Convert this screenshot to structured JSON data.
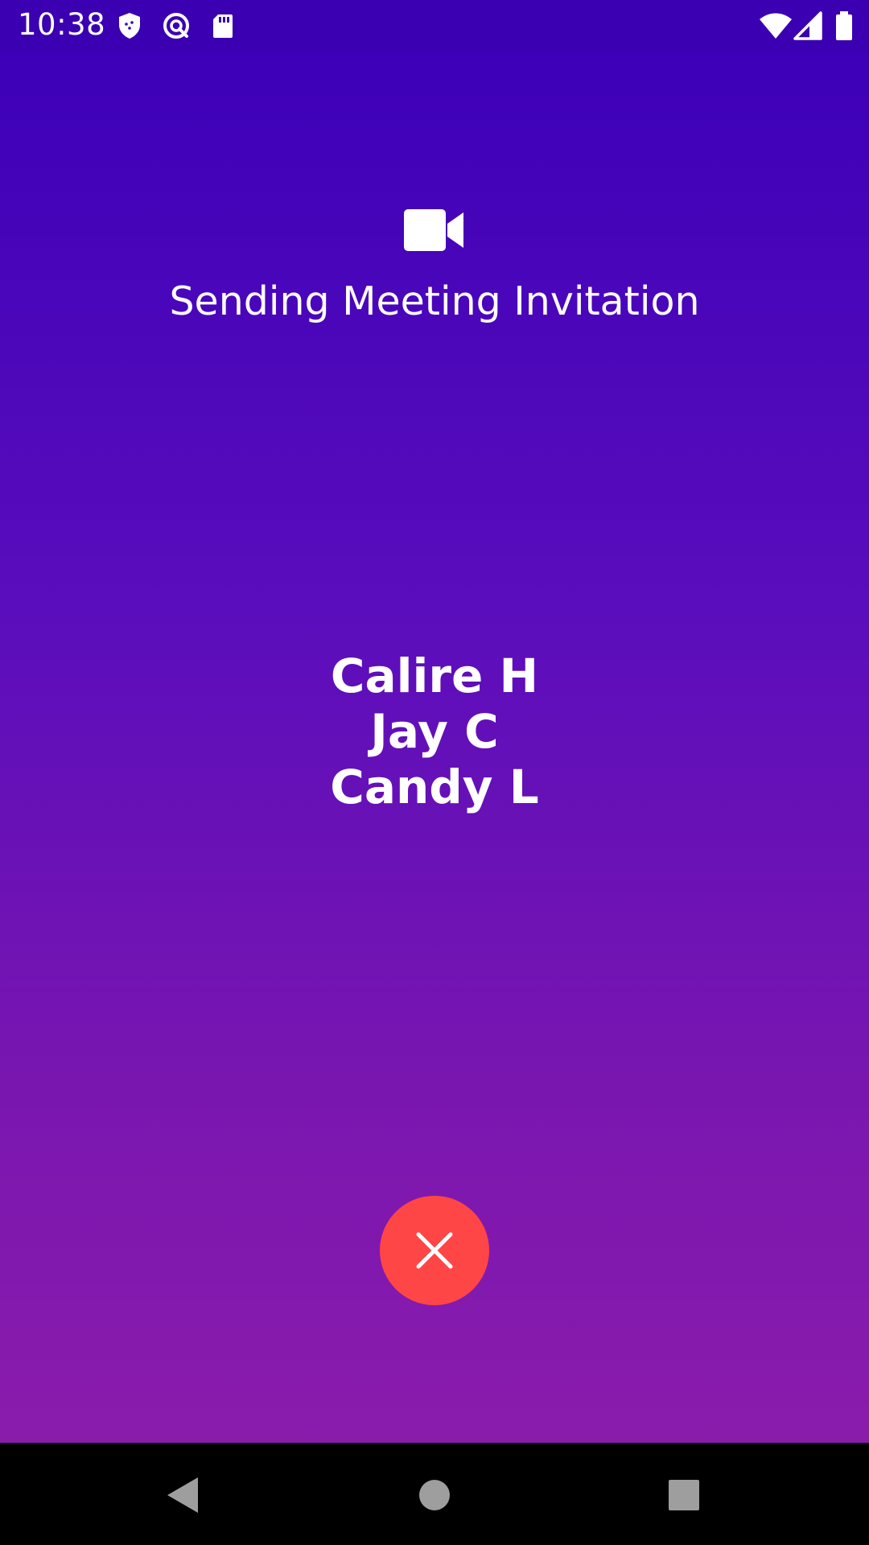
{
  "status_bar": {
    "time": "10:38",
    "left_icons": [
      "shield-icon",
      "sync-icon",
      "sd-card-icon"
    ],
    "right_icons": [
      "wifi-icon",
      "signal-icon",
      "battery-icon"
    ]
  },
  "call": {
    "icon": "video-camera-icon",
    "title": "Sending Meeting Invitation",
    "participants": [
      "Calire H",
      "Jay C",
      "Candy L"
    ],
    "cancel_icon": "close-icon"
  },
  "nav_bar": {
    "buttons": [
      "back-icon",
      "home-icon",
      "recents-icon"
    ]
  },
  "colors": {
    "status_bar": "#3a00b2",
    "gradient_top": "#3d00b8",
    "gradient_bottom": "#8a1cac",
    "cancel_button": "#ff4646",
    "text": "#ffffff"
  }
}
